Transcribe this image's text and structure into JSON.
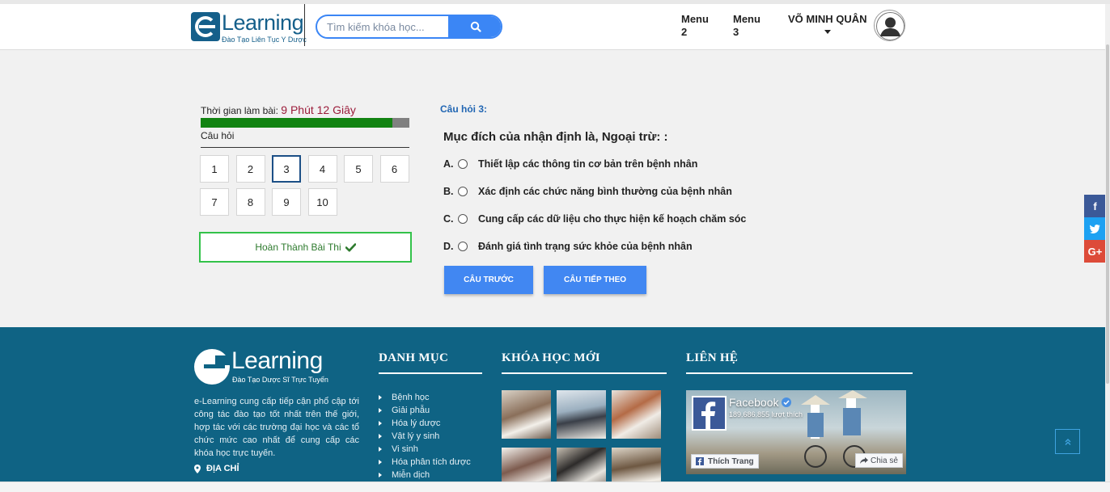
{
  "header": {
    "logo_word": "Learning",
    "logo_sub": "Đào Tạo Liên Tục Y Dược",
    "search_placeholder": "Tìm kiếm khóa học...",
    "menu2_line1": "Menu",
    "menu2_line2": "2",
    "menu3_line1": "Menu",
    "menu3_line2": "3",
    "user_name": "VÕ MINH QUÂN"
  },
  "quiz": {
    "timer_label": "Thời gian làm bài:",
    "timer_value": "9 Phút 12 Giây",
    "time_remaining_fraction": 0.92,
    "questions_label": "Câu hỏi",
    "question_numbers": [
      "1",
      "2",
      "3",
      "4",
      "5",
      "6",
      "7",
      "8",
      "9",
      "10"
    ],
    "active_question": 3,
    "finish_label": "Hoàn Thành Bài Thi",
    "question_number_label": "Câu hỏi 3:",
    "question_text": "Mục đích của nhận định là, Ngoại trừ: :",
    "answers": [
      {
        "letter": "A.",
        "text": "Thiết lập các thông tin cơ bản trên bệnh nhân"
      },
      {
        "letter": "B.",
        "text": "Xác định các chức năng bình thường của bệnh nhân"
      },
      {
        "letter": "C.",
        "text": "Cung cấp các dữ liệu cho thực hiện kế hoạch chăm sóc"
      },
      {
        "letter": "D.",
        "text": "Đánh giá tình trạng sức khỏe của bệnh nhân"
      }
    ],
    "prev_label": "CÂU TRƯỚC",
    "next_label": "CÂU TIẾP THEO"
  },
  "social": {
    "facebook_glyph": "f",
    "google_glyph": "G+",
    "colors": {
      "facebook": "#3b5998",
      "twitter": "#1da1f2",
      "google": "#dd4b39"
    }
  },
  "footer": {
    "logo_word": "Learning",
    "logo_sub": "Đào Tạo Dược Sĩ Trực Tuyến",
    "description": "e-Learning cung cấp tiếp cận phổ cập tới công tác đào tạo tốt nhất trên thế giới, hợp tác với các trường đại học và các tổ chức mức cao nhất để cung cấp các khóa học trực tuyến.",
    "address_label": "ĐỊA CHỈ",
    "categories_heading": "DANH MỤC",
    "categories": [
      "Bệnh học",
      "Giải phẫu",
      "Hóa lý dược",
      "Vật lý y sinh",
      "Vi sinh",
      "Hóa phân tích dược",
      "Miễn dịch"
    ],
    "new_courses_heading": "KHÓA HỌC MỚI",
    "contact_heading": "LIÊN HỆ",
    "fb_page_name": "Facebook",
    "fb_likes": "189.686.855 lượt thích",
    "fb_like_button": "Thích Trang",
    "fb_share_button": "Chia sẻ"
  },
  "colors": {
    "brand": "#155f8a",
    "accent_blue": "#4187f2",
    "footer_bg": "#0f6384",
    "progress_fill": "#128312",
    "timer_value": "#9b1c3a",
    "finish_border": "#33c24a"
  }
}
